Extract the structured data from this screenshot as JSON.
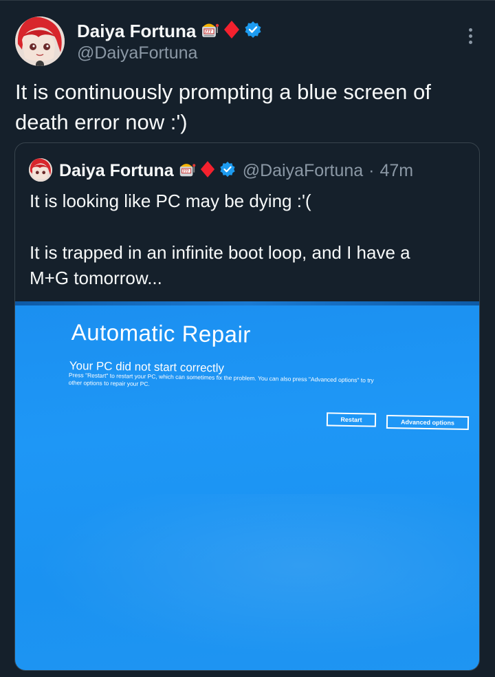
{
  "author": {
    "name": "Daiya Fortuna",
    "handle": "@DaiyaFortuna",
    "badges": [
      "slot-machine-icon",
      "diamond-suit-icon",
      "verified-icon"
    ]
  },
  "tweet": {
    "text_line1": "It is continuously prompting a blue screen of",
    "text_line2": "death error now :')"
  },
  "quoted_tweet": {
    "name": "Daiya Fortuna",
    "handle": "@DaiyaFortuna",
    "separator": "·",
    "time": "47m",
    "text_p1": "It is looking like PC may be dying :'(",
    "text_p2_line1": "It is trapped in an infinite boot loop, and I have a",
    "text_p2_line2": "M+G tomorrow...",
    "image": {
      "title": "Automatic Repair",
      "subtitle": "Your PC did not start correctly",
      "desc_line1": "Press \"Restart\" to restart your PC, which can sometimes fix the problem. You can also press \"Advanced options\" to try",
      "desc_line2": "other options to repair your PC.",
      "restart_label": "Restart",
      "advanced_label": "Advanced options"
    }
  },
  "colors": {
    "background": "#15202b",
    "text_primary": "#f7f9f9",
    "text_secondary": "#8b98a5",
    "verified": "#1d9bf0",
    "diamond": "#f4212e",
    "screen_blue": "#1a92f1"
  }
}
